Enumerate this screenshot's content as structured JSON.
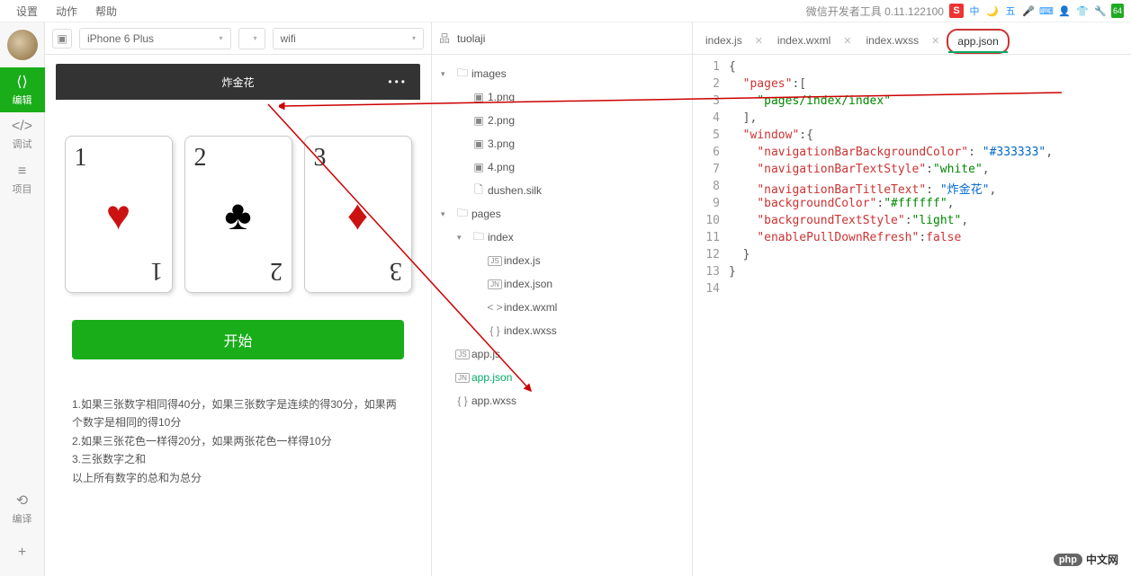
{
  "menu": {
    "settings": "设置",
    "actions": "动作",
    "help": "帮助"
  },
  "app_version": "微信开发者工具 0.11.122100",
  "status_icons": [
    "S",
    "中",
    "🌙",
    "五",
    "🎤",
    "⌨",
    "👤",
    "👕",
    "🔧",
    "64"
  ],
  "leftbar": {
    "edit": "编辑",
    "debug": "调试",
    "project": "项目",
    "compile": "编译"
  },
  "device": {
    "model": "iPhone 6 Plus",
    "scale": "",
    "network": "wifi"
  },
  "sim": {
    "title": "炸金花",
    "cards": [
      {
        "n": "1",
        "suit": "♥",
        "color": "red"
      },
      {
        "n": "2",
        "suit": "♣",
        "color": "black"
      },
      {
        "n": "3",
        "suit": "♦",
        "color": "red"
      }
    ],
    "start": "开始",
    "rules": [
      "1.如果三张数字相同得40分，如果三张数字是连续的得30分，如果两个数字是相同的得10分",
      "2.如果三张花色一样得20分，如果两张花色一样得10分",
      "3.三张数字之和",
      "以上所有数字的总和为总分"
    ]
  },
  "filetree": {
    "root": "tuolaji",
    "items": [
      {
        "type": "folder",
        "name": "images",
        "depth": 0,
        "open": true,
        "chev": "▾"
      },
      {
        "type": "img",
        "name": "1.png",
        "depth": 1
      },
      {
        "type": "img",
        "name": "2.png",
        "depth": 1
      },
      {
        "type": "img",
        "name": "3.png",
        "depth": 1
      },
      {
        "type": "img",
        "name": "4.png",
        "depth": 1
      },
      {
        "type": "file",
        "name": "dushen.silk",
        "depth": 1,
        "ic": "📄"
      },
      {
        "type": "folder",
        "name": "pages",
        "depth": 0,
        "open": true,
        "chev": "▾"
      },
      {
        "type": "folder",
        "name": "index",
        "depth": 1,
        "open": true,
        "chev": "▾"
      },
      {
        "type": "js",
        "name": "index.js",
        "depth": 2
      },
      {
        "type": "jn",
        "name": "index.json",
        "depth": 2
      },
      {
        "type": "xml",
        "name": "index.wxml",
        "depth": 2
      },
      {
        "type": "css",
        "name": "index.wxss",
        "depth": 2
      },
      {
        "type": "js",
        "name": "app.js",
        "depth": 0
      },
      {
        "type": "jn",
        "name": "app.json",
        "depth": 0,
        "sel": true
      },
      {
        "type": "css",
        "name": "app.wxss",
        "depth": 0
      }
    ]
  },
  "tabs": [
    {
      "label": "index.js",
      "active": false,
      "close": true
    },
    {
      "label": "index.wxml",
      "active": false,
      "close": true
    },
    {
      "label": "index.wxss",
      "active": false,
      "close": true
    },
    {
      "label": "app.json",
      "active": true,
      "close": false,
      "hl": true
    }
  ],
  "code_lines": [
    "1",
    "2",
    "3",
    "4",
    "5",
    "6",
    "7",
    "8",
    "9",
    "10",
    "11",
    "12",
    "13",
    "14"
  ],
  "code": {
    "l1": "{",
    "l2_k": "\"pages\"",
    "l2_r": ":[",
    "l3": "\"pages/index/index\"",
    "l4": "],",
    "l5_k": "\"window\"",
    "l5_r": ":{",
    "l6_k": "\"navigationBarBackgroundColor\"",
    "l6_v": "\"#333333\"",
    "l7_k": "\"navigationBarTextStyle\"",
    "l7_v": "\"white\"",
    "l8_k": "\"navigationBarTitleText\"",
    "l8_v": "\"炸金花\"",
    "l9_k": "\"backgroundColor\"",
    "l9_v": "\"#ffffff\"",
    "l10_k": "\"backgroundTextStyle\"",
    "l10_v": "\"light\"",
    "l11_k": "\"enablePullDownRefresh\"",
    "l11_v": "false",
    "l12": "}",
    "l13": "}"
  },
  "watermark": "中文网"
}
